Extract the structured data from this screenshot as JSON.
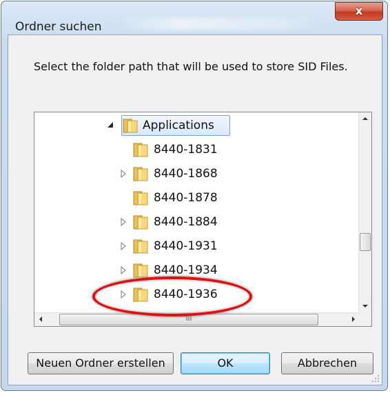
{
  "dialog": {
    "title": "Ordner suchen",
    "close_symbol": "x",
    "instruction": "Select the folder path that will be used to store SID Files."
  },
  "tree": {
    "parent": {
      "label": "Applications",
      "expanded": true,
      "selected": true,
      "icon": "folder-icon"
    },
    "items": [
      {
        "label": "8440-1831",
        "has_children": false,
        "icon": "folder-icon"
      },
      {
        "label": "8440-1868",
        "has_children": true,
        "icon": "folder-icon"
      },
      {
        "label": "8440-1878",
        "has_children": false,
        "icon": "folder-icon"
      },
      {
        "label": "8440-1884",
        "has_children": true,
        "icon": "folder-icon"
      },
      {
        "label": "8440-1931",
        "has_children": true,
        "icon": "folder-icon"
      },
      {
        "label": "8440-1934",
        "has_children": true,
        "icon": "folder-icon"
      },
      {
        "label": "8440-1936",
        "has_children": true,
        "icon": "folder-icon",
        "highlighted": true
      }
    ],
    "hscroll_grip": "III"
  },
  "buttons": {
    "new_folder": "Neuen Ordner erstellen",
    "ok": "OK",
    "cancel": "Abbrechen"
  },
  "colors": {
    "highlight_ring": "#e01010",
    "close_button": "#c1381f",
    "default_button_border": "#3c7fb1"
  }
}
